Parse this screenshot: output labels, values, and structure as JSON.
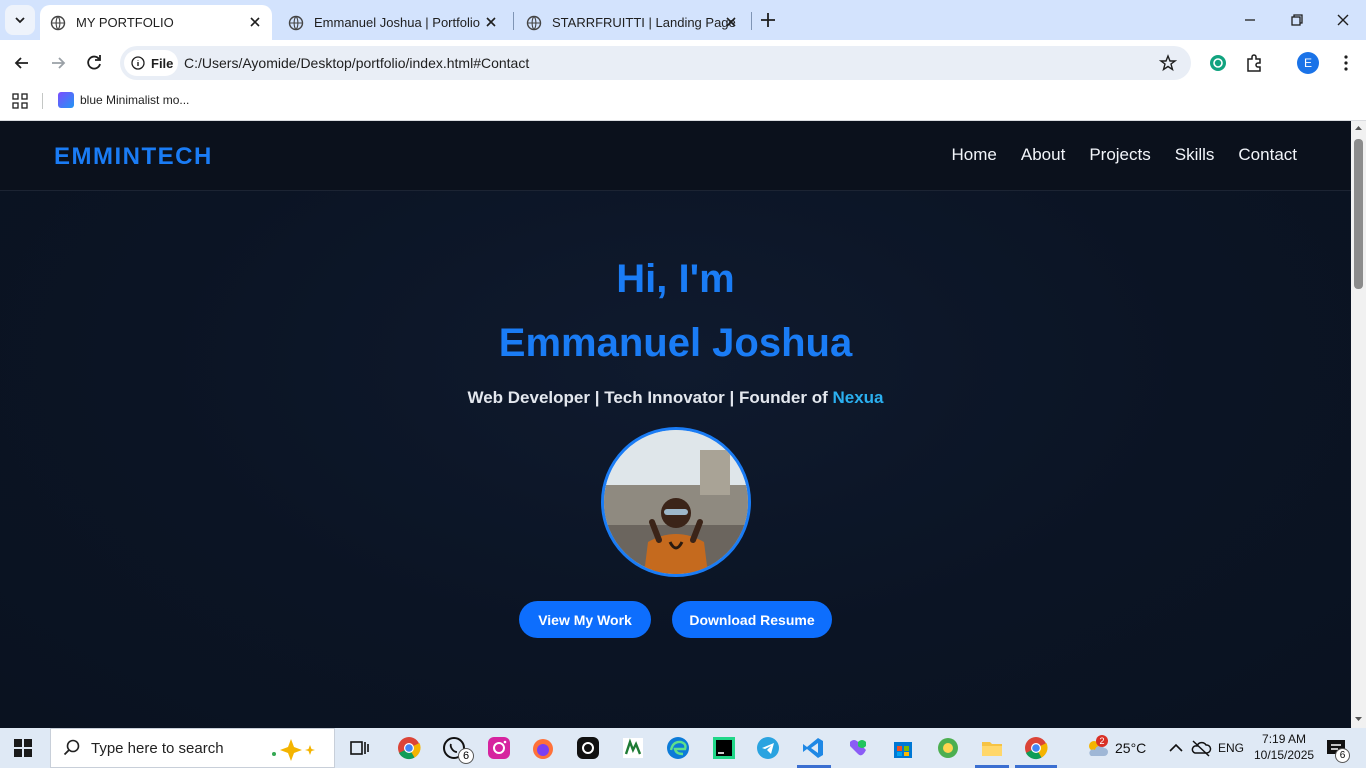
{
  "browser": {
    "tabs": [
      {
        "title": "MY PORTFOLIO",
        "active": true
      },
      {
        "title": "Emmanuel Joshua | Portfolio",
        "active": false
      },
      {
        "title": "STARRFRUITTI | Landing Page",
        "active": false
      }
    ],
    "address": {
      "chip_label": "File",
      "url": "C:/Users/Ayomide/Desktop/portfolio/index.html#Contact"
    },
    "profile_initial": "E",
    "bookmarks": [
      {
        "label": "blue Minimalist mo..."
      }
    ]
  },
  "site": {
    "logo": "EMMINTECH",
    "nav": [
      "Home",
      "About",
      "Projects",
      "Skills",
      "Contact"
    ],
    "hero": {
      "greeting": "Hi, I'm",
      "name": "Emmanuel Joshua",
      "subtitle_prefix": "Web Developer | Tech Innovator | Founder of ",
      "subtitle_brand": "Nexua",
      "primary_button": "View My Work",
      "secondary_button": "Download Resume"
    }
  },
  "taskbar": {
    "search_placeholder": "Type here to search",
    "whatsapp_badge": "6",
    "weather_badge": "2",
    "temperature": "25°C",
    "language": "ENG",
    "time": "7:19 AM",
    "date": "10/15/2025",
    "notifications_badge": "6"
  },
  "colors": {
    "accent": "#1a7cf5",
    "button": "#0d6efd",
    "brand_highlight": "#2bb0f0",
    "page_bg": "#0b1424"
  }
}
